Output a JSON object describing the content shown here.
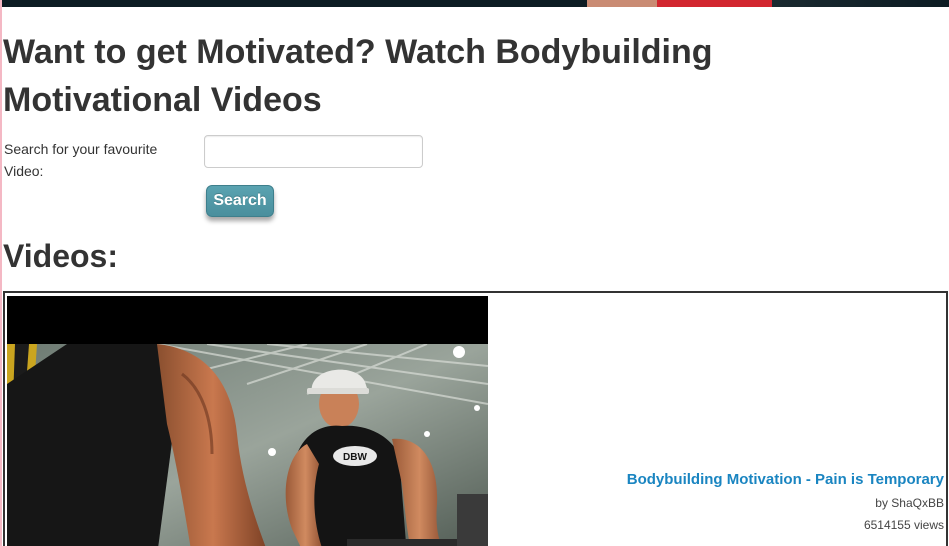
{
  "page": {
    "title": "Want to get Motivated? Watch Bodybuilding Motivational Videos"
  },
  "search": {
    "label": "Search for your favourite Video:",
    "value": "",
    "placeholder": "",
    "button_label": "Search"
  },
  "videos": {
    "heading": "Videos:",
    "items": [
      {
        "title": "Bodybuilding Motivation - Pain is Temporary",
        "author": "by ShaQxBB",
        "views": "6514155 views",
        "thumbnail": "bodybuilder-pushup-thumbnail"
      }
    ]
  },
  "colors": {
    "link": "#1a85c1",
    "button": "#4a8f9d",
    "text": "#333333"
  }
}
